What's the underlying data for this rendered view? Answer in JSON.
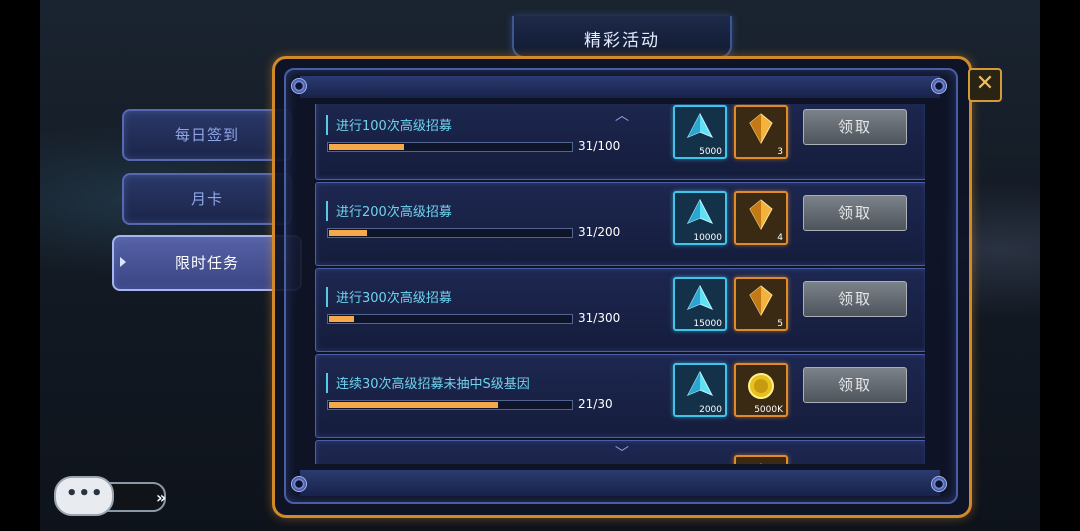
{
  "title": "精彩活动",
  "close_label": "✕",
  "tabs": [
    {
      "label": "每日签到",
      "active": false
    },
    {
      "label": "月卡",
      "active": false
    },
    {
      "label": "限时任务",
      "active": true
    }
  ],
  "tasks": [
    {
      "title": "进行100次高级招募",
      "count": "31/100",
      "progress": 0.31,
      "reward1": "5000",
      "reward2": "3",
      "reward2_type": "gold-crystal",
      "claim": "领取"
    },
    {
      "title": "进行200次高级招募",
      "count": "31/200",
      "progress": 0.155,
      "reward1": "10000",
      "reward2": "4",
      "reward2_type": "gold-crystal",
      "claim": "领取"
    },
    {
      "title": "进行300次高级招募",
      "count": "31/300",
      "progress": 0.103,
      "reward1": "15000",
      "reward2": "5",
      "reward2_type": "gold-crystal",
      "claim": "领取"
    },
    {
      "title": "连续30次高级招募未抽中S级基因",
      "count": "21/30",
      "progress": 0.7,
      "reward1": "2000",
      "reward2": "5000K",
      "reward2_type": "gold-coin",
      "claim": "领取"
    }
  ],
  "colors": {
    "accent_cyan": "#40c4ea",
    "accent_gold": "#e08a28",
    "progress": "#f6a84a"
  },
  "icons": {
    "reward1": "blue-crystal-icon",
    "reward2a": "gold-crystal-icon",
    "reward2b": "gold-coin-icon",
    "scroll_up": "chevron-up-icon",
    "scroll_down": "chevron-down-icon",
    "chat": "chat-bubble-icon"
  }
}
